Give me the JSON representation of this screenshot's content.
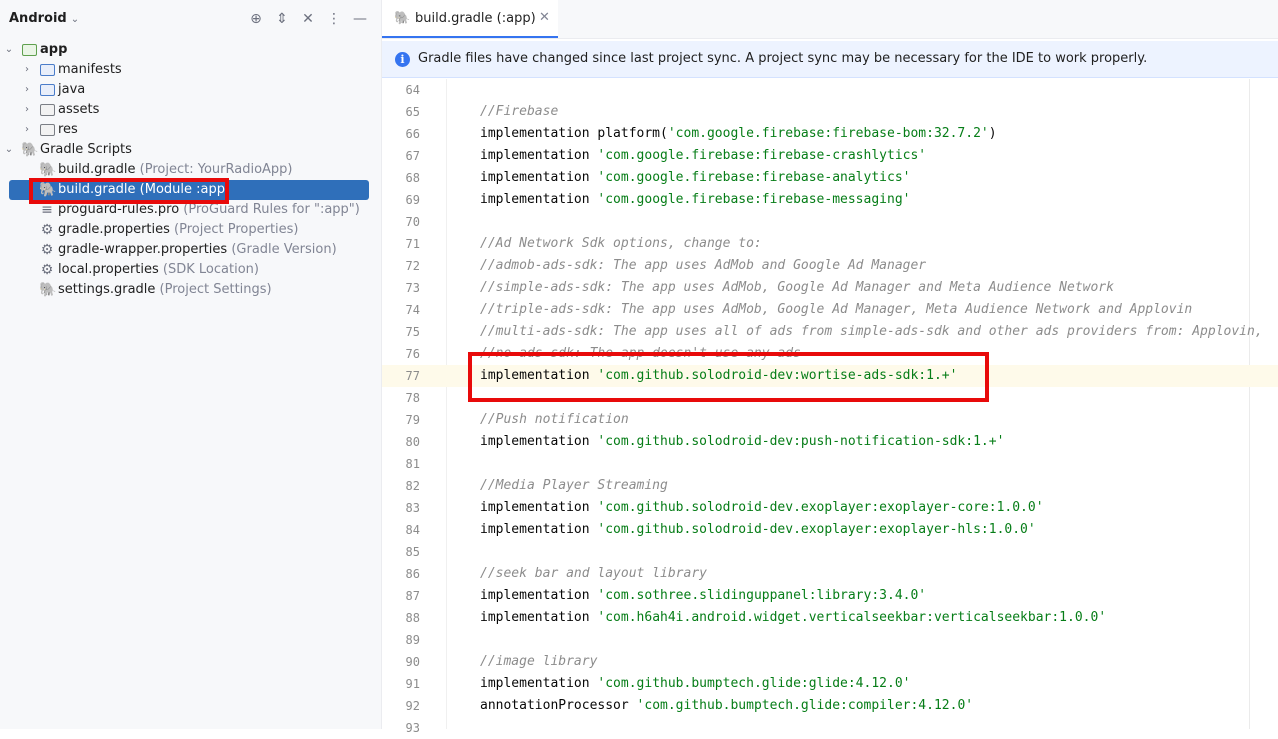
{
  "project_panel": {
    "title": "Android",
    "tree": [
      {
        "label": "app",
        "hint": "",
        "bold": true
      },
      {
        "label": "manifests",
        "hint": ""
      },
      {
        "label": "java",
        "hint": ""
      },
      {
        "label": "assets",
        "hint": ""
      },
      {
        "label": "res",
        "hint": ""
      },
      {
        "label": "Gradle Scripts",
        "hint": ""
      },
      {
        "label": "build.gradle",
        "hint": "(Project: YourRadioApp)"
      },
      {
        "label": "build.gradle",
        "hint": "(Module :app)"
      },
      {
        "label": "proguard-rules.pro",
        "hint": "(ProGuard Rules for \":app\")"
      },
      {
        "label": "gradle.properties",
        "hint": "(Project Properties)"
      },
      {
        "label": "gradle-wrapper.properties",
        "hint": "(Gradle Version)"
      },
      {
        "label": "local.properties",
        "hint": "(SDK Location)"
      },
      {
        "label": "settings.gradle",
        "hint": "(Project Settings)"
      }
    ]
  },
  "editor": {
    "tab_label": "build.gradle (:app)",
    "banner_text": "Gradle files have changed since last project sync. A project sync may be necessary for the IDE to work properly.",
    "lines": [
      {
        "n": "64",
        "kw": "",
        "str": "",
        "comment": "",
        "tail": ""
      },
      {
        "n": "65",
        "kw": "",
        "str": "",
        "comment": "//Firebase",
        "tail": ""
      },
      {
        "n": "66",
        "kw": "implementation platform(",
        "str": "'com.google.firebase:firebase-bom:32.7.2'",
        "comment": "",
        "tail": ")"
      },
      {
        "n": "67",
        "kw": "implementation ",
        "str": "'com.google.firebase:firebase-crashlytics'",
        "comment": "",
        "tail": ""
      },
      {
        "n": "68",
        "kw": "implementation ",
        "str": "'com.google.firebase:firebase-analytics'",
        "comment": "",
        "tail": ""
      },
      {
        "n": "69",
        "kw": "implementation ",
        "str": "'com.google.firebase:firebase-messaging'",
        "comment": "",
        "tail": ""
      },
      {
        "n": "70",
        "kw": "",
        "str": "",
        "comment": "",
        "tail": ""
      },
      {
        "n": "71",
        "kw": "",
        "str": "",
        "comment": "//Ad Network Sdk options, change to:",
        "tail": ""
      },
      {
        "n": "72",
        "kw": "",
        "str": "",
        "comment": "//admob-ads-sdk: The app uses AdMob and Google Ad Manager",
        "tail": ""
      },
      {
        "n": "73",
        "kw": "",
        "str": "",
        "comment": "//simple-ads-sdk: The app uses AdMob, Google Ad Manager and Meta Audience Network",
        "tail": ""
      },
      {
        "n": "74",
        "kw": "",
        "str": "",
        "comment": "//triple-ads-sdk: The app uses AdMob, Google Ad Manager, Meta Audience Network and Applovin",
        "tail": ""
      },
      {
        "n": "75",
        "kw": "",
        "str": "",
        "comment": "//multi-ads-sdk: The app uses all of ads from simple-ads-sdk and other ads providers from: Applovin,",
        "tail": ""
      },
      {
        "n": "76",
        "kw": "",
        "str": "",
        "comment": "//no-ads-sdk: The app doesn't use any ads",
        "tail": ""
      },
      {
        "n": "77",
        "kw": "implementation ",
        "str": "'com.github.solodroid-dev:wortise-ads-sdk:1.+'",
        "comment": "",
        "tail": ""
      },
      {
        "n": "78",
        "kw": "",
        "str": "",
        "comment": "",
        "tail": ""
      },
      {
        "n": "79",
        "kw": "",
        "str": "",
        "comment": "//Push notification",
        "tail": ""
      },
      {
        "n": "80",
        "kw": "implementation ",
        "str": "'com.github.solodroid-dev:push-notification-sdk:1.+'",
        "comment": "",
        "tail": ""
      },
      {
        "n": "81",
        "kw": "",
        "str": "",
        "comment": "",
        "tail": ""
      },
      {
        "n": "82",
        "kw": "",
        "str": "",
        "comment": "//Media Player Streaming",
        "tail": ""
      },
      {
        "n": "83",
        "kw": "implementation ",
        "str": "'com.github.solodroid-dev.exoplayer:exoplayer-core:1.0.0'",
        "comment": "",
        "tail": ""
      },
      {
        "n": "84",
        "kw": "implementation ",
        "str": "'com.github.solodroid-dev.exoplayer:exoplayer-hls:1.0.0'",
        "comment": "",
        "tail": ""
      },
      {
        "n": "85",
        "kw": "",
        "str": "",
        "comment": "",
        "tail": ""
      },
      {
        "n": "86",
        "kw": "",
        "str": "",
        "comment": "//seek bar and layout library",
        "tail": ""
      },
      {
        "n": "87",
        "kw": "implementation ",
        "str": "'com.sothree.slidinguppanel:library:3.4.0'",
        "comment": "",
        "tail": ""
      },
      {
        "n": "88",
        "kw": "implementation ",
        "str": "'com.h6ah4i.android.widget.verticalseekbar:verticalseekbar:1.0.0'",
        "comment": "",
        "tail": ""
      },
      {
        "n": "89",
        "kw": "",
        "str": "",
        "comment": "",
        "tail": ""
      },
      {
        "n": "90",
        "kw": "",
        "str": "",
        "comment": "//image library",
        "tail": ""
      },
      {
        "n": "91",
        "kw": "implementation ",
        "str": "'com.github.bumptech.glide:glide:4.12.0'",
        "comment": "",
        "tail": ""
      },
      {
        "n": "92",
        "kw": "annotationProcessor ",
        "str": "'com.github.bumptech.glide:compiler:4.12.0'",
        "comment": "",
        "tail": ""
      },
      {
        "n": "93",
        "kw": "",
        "str": "",
        "comment": "",
        "tail": ""
      }
    ]
  },
  "colors": {
    "selection": "#2f6fba",
    "highlight_box": "#e80a0a",
    "string": "#067d17",
    "comment": "#8c8c8c"
  }
}
